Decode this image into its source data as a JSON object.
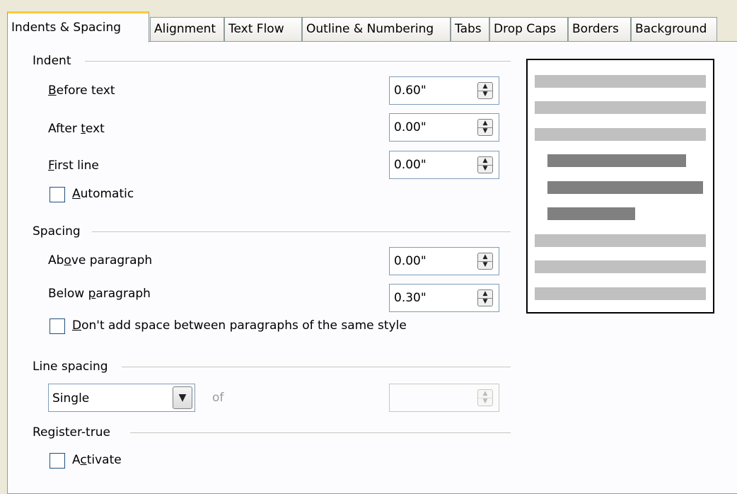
{
  "tabs": [
    {
      "label": "Indents & Spacing",
      "active": true
    },
    {
      "label": "Alignment"
    },
    {
      "label": "Text Flow"
    },
    {
      "label": "Outline & Numbering"
    },
    {
      "label": "Tabs"
    },
    {
      "label": "Drop Caps"
    },
    {
      "label": "Borders"
    },
    {
      "label": "Background"
    }
  ],
  "indent": {
    "title": "Indent",
    "before_text": {
      "label_pre": "",
      "label_key": "B",
      "label_post": "efore text",
      "value": "0.60\""
    },
    "after_text": {
      "label_pre": "After ",
      "label_key": "t",
      "label_post": "ext",
      "value": "0.00\""
    },
    "first_line": {
      "label_pre": "",
      "label_key": "F",
      "label_post": "irst line",
      "value": "0.00\""
    },
    "automatic": {
      "label_pre": "",
      "label_key": "A",
      "label_post": "utomatic",
      "checked": false
    }
  },
  "spacing": {
    "title": "Spacing",
    "above": {
      "label_pre": "Ab",
      "label_key": "o",
      "label_post": "ve paragraph",
      "value": "0.00\""
    },
    "below": {
      "label_pre": "Below ",
      "label_key": "p",
      "label_post": "aragraph",
      "value": "0.30\""
    },
    "dont_add": {
      "label_pre": "",
      "label_key": "D",
      "label_post": "on't add space between paragraphs of the same style",
      "checked": false
    }
  },
  "line_spacing": {
    "title": "Line spacing",
    "selected": "Single",
    "of_label": "of",
    "value": ""
  },
  "register_true": {
    "title": "Register-true",
    "activate": {
      "label_pre": "A",
      "label_key": "c",
      "label_post": "tivate",
      "checked": false
    }
  },
  "colors": {
    "preview_light": "#c0c0c0",
    "preview_dark": "#808080",
    "tab_highlight": "#ffc83c"
  }
}
